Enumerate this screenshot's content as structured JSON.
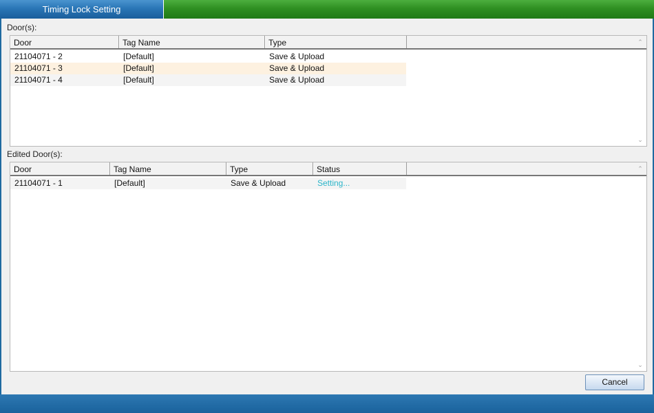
{
  "window": {
    "title": "Timing Lock Setting"
  },
  "doors_section": {
    "label": "Door(s):",
    "columns": [
      "Door",
      "Tag Name",
      "Type"
    ],
    "rows": [
      {
        "door": "21104071 - 2",
        "tag": "[Default]",
        "type": "Save & Upload"
      },
      {
        "door": "21104071 - 3",
        "tag": "[Default]",
        "type": "Save & Upload"
      },
      {
        "door": "21104071 - 4",
        "tag": "[Default]",
        "type": "Save & Upload"
      }
    ]
  },
  "edited_section": {
    "label": "Edited Door(s):",
    "columns": [
      "Door",
      "Tag Name",
      "Type",
      "Status"
    ],
    "rows": [
      {
        "door": "21104071 - 1",
        "tag": "[Default]",
        "type": "Save & Upload",
        "status": "Setting..."
      }
    ]
  },
  "buttons": {
    "cancel": "Cancel"
  },
  "icons": {
    "scroll_up": "chevron-up-icon",
    "scroll_down": "chevron-down-icon"
  },
  "colors": {
    "title_tab": "#2a76b6",
    "title_bar": "#2f8f22",
    "status_text": "#2bb5c9",
    "selected_row": "#fdf1e0"
  }
}
